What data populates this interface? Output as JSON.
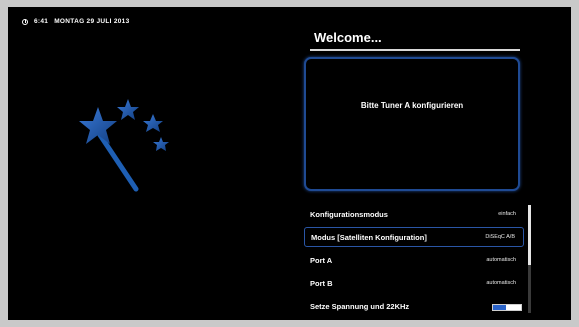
{
  "status_bar": {
    "time": "6:41",
    "date": "MONTAG 29 JULI 2013"
  },
  "wizard": {
    "title": "Welcome...",
    "message": "Bitte Tuner A konfigurieren",
    "icon": "magic-wand-icon"
  },
  "settings": [
    {
      "label": "Konfigurationsmodus",
      "value": "einfach",
      "selected": false
    },
    {
      "label": "Modus [Satelliten Konfiguration]",
      "value": "DiSEqC A/B",
      "selected": true
    },
    {
      "label": "Port A",
      "value": "automatisch",
      "selected": false
    },
    {
      "label": "Port B",
      "value": "automatisch",
      "selected": false
    },
    {
      "label": "Setze Spannung und 22KHz",
      "toggle_level": 0.45,
      "selected": false
    }
  ],
  "colors": {
    "accent": "#2a56a6",
    "wand": "#1e5fb4",
    "background": "#000000"
  }
}
